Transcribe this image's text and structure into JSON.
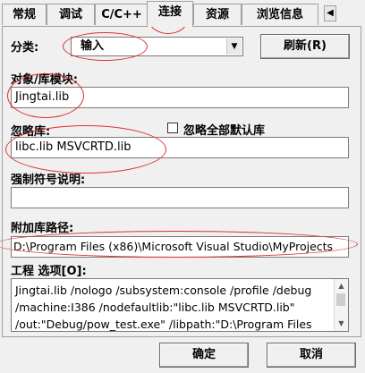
{
  "tabs": [
    {
      "label": "常规"
    },
    {
      "label": "调试"
    },
    {
      "label": "C/C++"
    },
    {
      "label": "连接"
    },
    {
      "label": "资源"
    },
    {
      "label": "浏览信息"
    }
  ],
  "tab_scroll_left": "◀",
  "category": {
    "label": "分类:",
    "value": "输入"
  },
  "reset_button": "刷新(R)",
  "object_libs": {
    "label": "对象/库模块:",
    "value": "Jingtai.lib"
  },
  "ignore_libs": {
    "label": "忽略库:",
    "value": "libc.lib MSVCRTD.lib"
  },
  "ignore_all": {
    "label": "忽略全部默认库"
  },
  "force_symbols": {
    "label": "强制符号说明:",
    "value": ""
  },
  "extra_lib_path": {
    "label": "附加库路径:",
    "value": "D:\\Program Files (x86)\\Microsoft Visual Studio\\MyProjects"
  },
  "project_options": {
    "label": "工程 选项[O]:",
    "lines": [
      "Jingtai.lib /nologo /subsystem:console /profile /debug",
      "/machine:I386 /nodefaultlib:\"libc.lib MSVCRTD.lib\"",
      "/out:\"Debug/pow_test.exe\" /libpath:\"D:\\Program Files"
    ]
  },
  "ok_button": "确定",
  "cancel_button": "取消"
}
